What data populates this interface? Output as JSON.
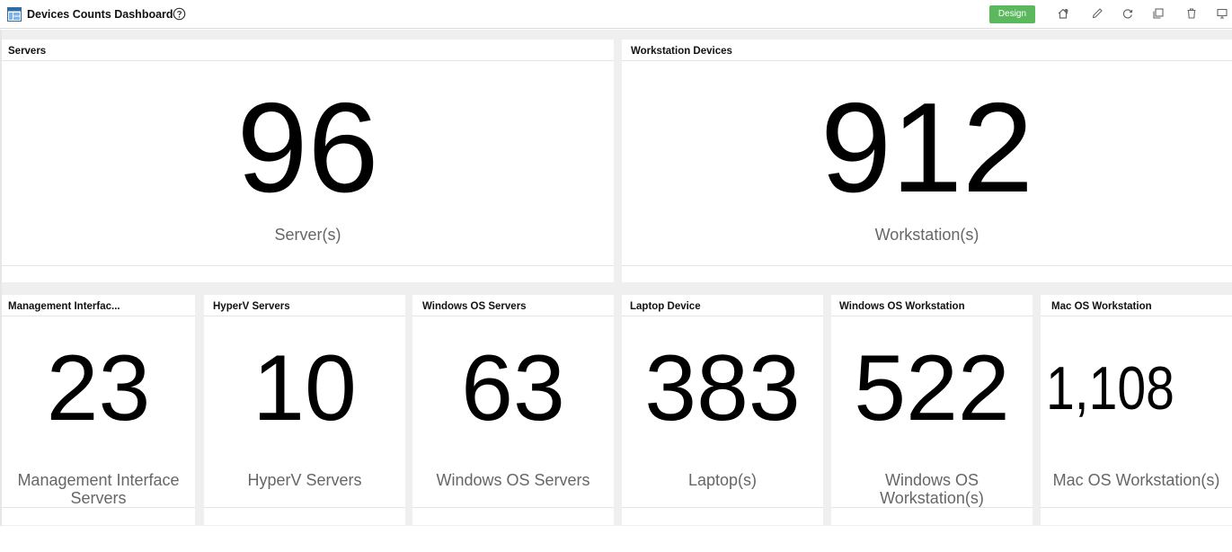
{
  "header": {
    "title": "Devices Counts Dashboard",
    "design_label": "Design",
    "colors": {
      "design_button": "#5cb85c",
      "logo": "#2e6da4"
    },
    "icons": [
      "dashboard-logo-icon",
      "help-icon",
      "home-settings-icon",
      "edit-icon",
      "refresh-icon",
      "clone-icon",
      "delete-icon",
      "present-icon"
    ]
  },
  "widgets": {
    "servers": {
      "title": "Servers",
      "value": "96",
      "caption": "Server(s)"
    },
    "workstations": {
      "title": "Workstation Devices",
      "value": "912",
      "caption": "Workstation(s)"
    },
    "management": {
      "title": "Management Interfac...",
      "value": "23",
      "caption": "Management Interface Servers"
    },
    "hyperv": {
      "title": "HyperV Servers",
      "value": "10",
      "caption": "HyperV Servers"
    },
    "windows_servers": {
      "title": "Windows OS Servers",
      "value": "63",
      "caption": "Windows OS Servers"
    },
    "laptop": {
      "title": "Laptop Device",
      "value": "383",
      "caption": "Laptop(s)"
    },
    "windows_workstation": {
      "title": "Windows OS Workstation",
      "value": "522",
      "caption": "Windows OS Workstation(s)"
    },
    "mac_workstation": {
      "title": "Mac OS Workstation",
      "value": "1,108",
      "caption": "Mac OS Workstation(s)"
    }
  }
}
